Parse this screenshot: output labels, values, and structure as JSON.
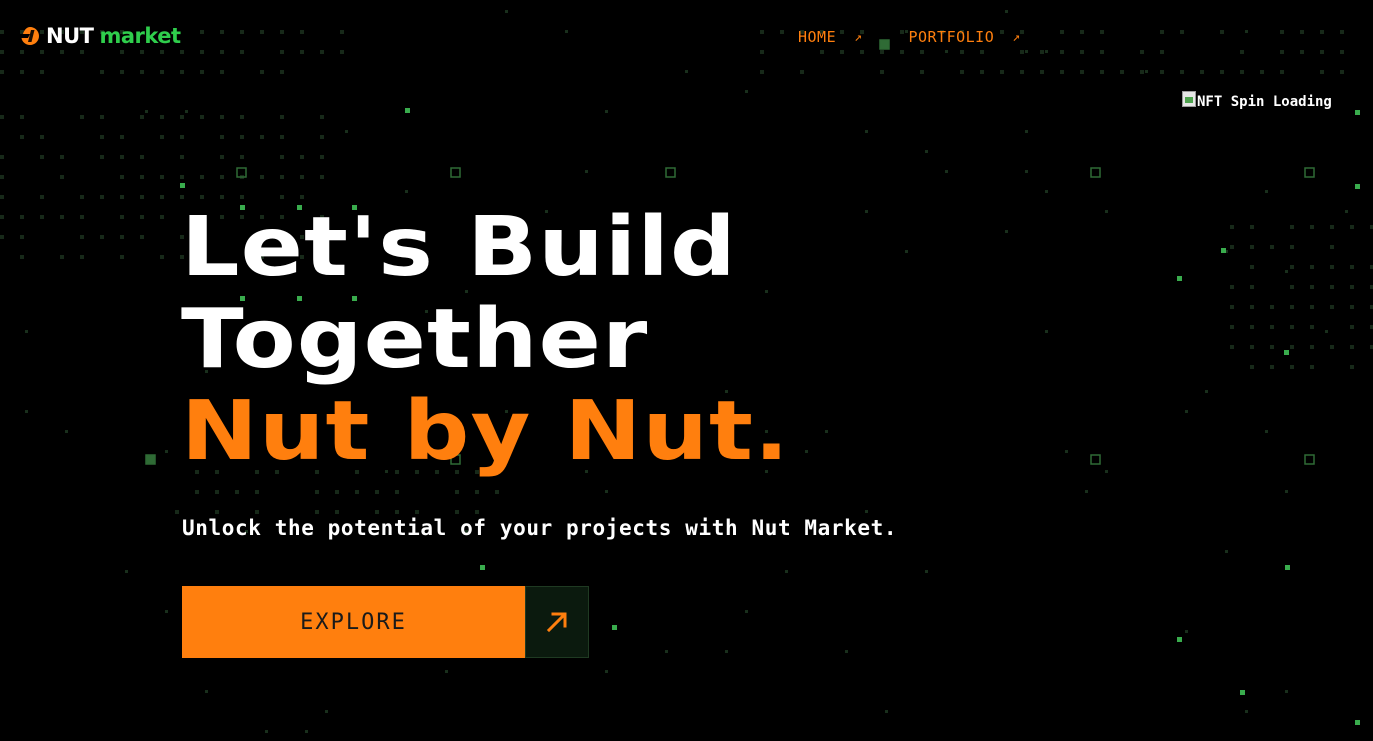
{
  "brand": {
    "name_part1": "NUT",
    "name_part2": "market",
    "logo_icon": "nut-logo-icon",
    "colors": {
      "orange": "#ff7f0e",
      "green": "#2fce4c",
      "background": "#000000"
    }
  },
  "nav": {
    "items": [
      {
        "label": "HOME",
        "icon": "arrow-up-right-icon",
        "glyph": "↗"
      },
      {
        "label": "PORTFOLIO",
        "icon": "arrow-up-right-icon",
        "glyph": "↗"
      }
    ]
  },
  "nft_image": {
    "alt": "NFT Spin Loading"
  },
  "hero": {
    "line1": "Let's Build",
    "line2": "Together",
    "line3": "Nut by Nut."
  },
  "subtitle": "Unlock the potential of your projects with Nut Market.",
  "cta": {
    "label": "EXPLORE",
    "icon": "arrow-up-right-icon"
  }
}
